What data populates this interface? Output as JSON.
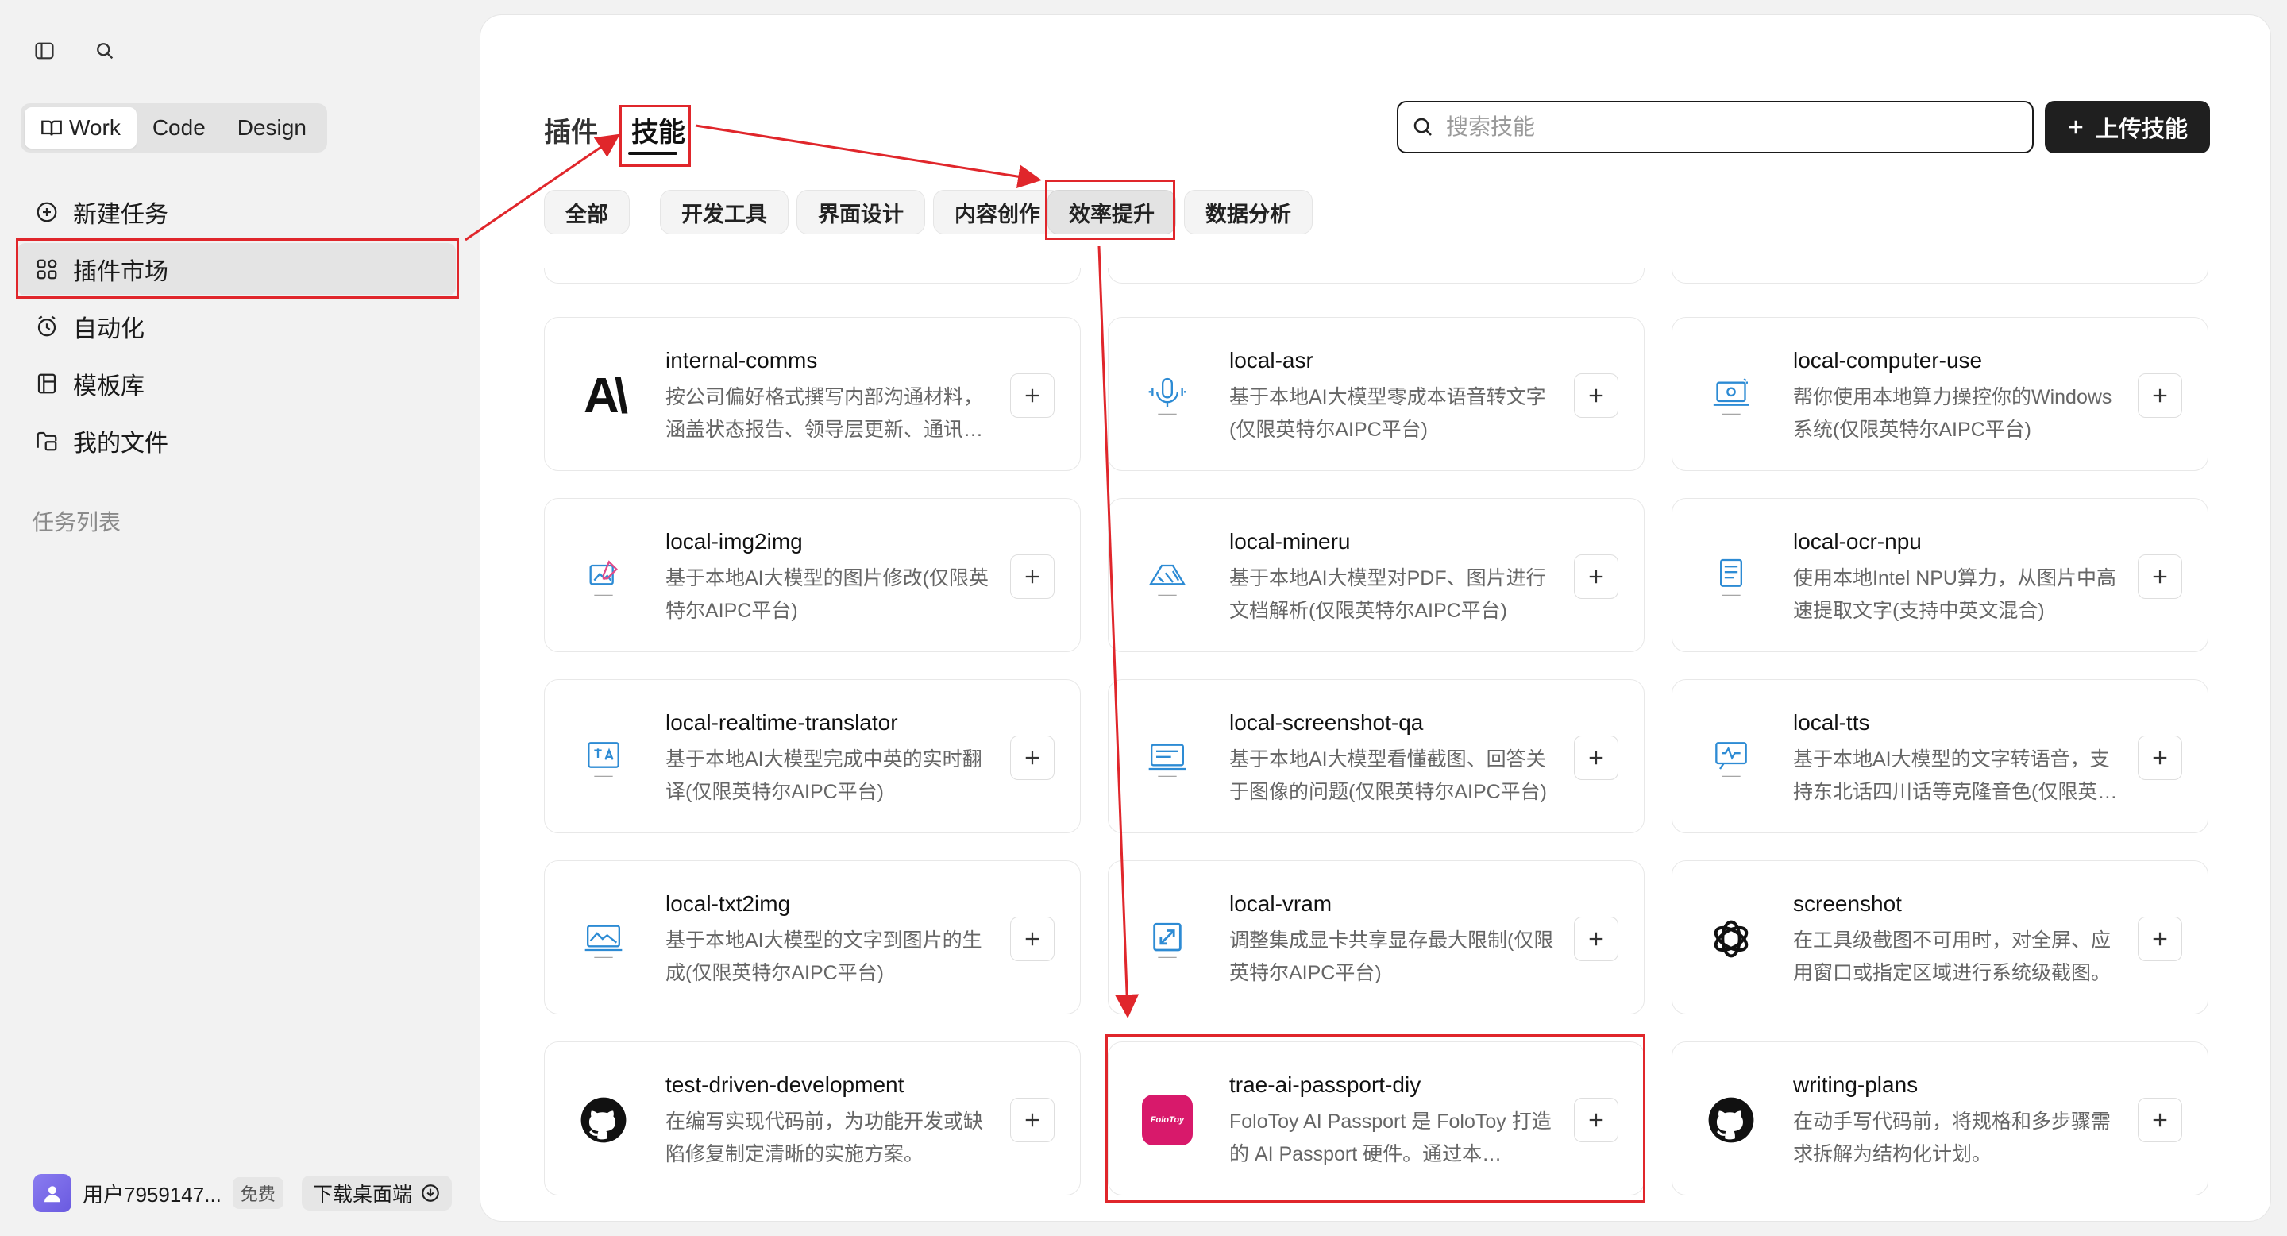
{
  "sidebar": {
    "modes": [
      "Work",
      "Code",
      "Design"
    ],
    "nav": [
      {
        "label": "新建任务",
        "icon": "plus-circle-icon"
      },
      {
        "label": "插件市场",
        "icon": "apps-icon"
      },
      {
        "label": "自动化",
        "icon": "clock-icon"
      },
      {
        "label": "模板库",
        "icon": "template-icon"
      },
      {
        "label": "我的文件",
        "icon": "folder-icon"
      }
    ],
    "section_title": "任务列表",
    "user": {
      "name": "用户7959147...",
      "plan": "免费"
    },
    "download_label": "下载桌面端"
  },
  "header": {
    "tabs": [
      "插件",
      "技能"
    ],
    "search_placeholder": "搜索技能",
    "upload_label": "上传技能"
  },
  "categories": [
    "全部",
    "开发工具",
    "界面设计",
    "内容创作",
    "效率提升",
    "数据分析"
  ],
  "skills": [
    {
      "title": "internal-comms",
      "desc": "按公司偏好格式撰写内部沟通材料，涵盖状态报告、领导层更新、通讯…",
      "icon": "anthropic-logo-icon"
    },
    {
      "title": "local-asr",
      "desc": "基于本地AI大模型零成本语音转文字(仅限英特尔AIPC平台)",
      "icon": "microphone-icon"
    },
    {
      "title": "local-computer-use",
      "desc": "帮你使用本地算力操控你的Windows系统(仅限英特尔AIPC平台)",
      "icon": "computer-icon"
    },
    {
      "title": "local-img2img",
      "desc": "基于本地AI大模型的图片修改(仅限英特尔AIPC平台)",
      "icon": "image-edit-icon"
    },
    {
      "title": "local-mineru",
      "desc": "基于本地AI大模型对PDF、图片进行文档解析(仅限英特尔AIPC平台)",
      "icon": "document-parse-icon"
    },
    {
      "title": "local-ocr-npu",
      "desc": "使用本地Intel NPU算力，从图片中高速提取文字(支持中英文混合)",
      "icon": "ocr-document-icon"
    },
    {
      "title": "local-realtime-translator",
      "desc": "基于本地AI大模型完成中英的实时翻译(仅限英特尔AIPC平台)",
      "icon": "translate-icon"
    },
    {
      "title": "local-screenshot-qa",
      "desc": "基于本地AI大模型看懂截图、回答关于图像的问题(仅限英特尔AIPC平台)",
      "icon": "screenshot-qa-icon"
    },
    {
      "title": "local-tts",
      "desc": "基于本地AI大模型的文字转语音，支持东北话四川话等克隆音色(仅限英…",
      "icon": "speech-icon"
    },
    {
      "title": "local-txt2img",
      "desc": "基于本地AI大模型的文字到图片的生成(仅限英特尔AIPC平台)",
      "icon": "text-to-image-icon"
    },
    {
      "title": "local-vram",
      "desc": "调整集成显卡共享显存最大限制(仅限英特尔AIPC平台)",
      "icon": "memory-expand-icon"
    },
    {
      "title": "screenshot",
      "desc": "在工具级截图不可用时，对全屏、应用窗口或指定区域进行系统级截图。",
      "icon": "openai-logo-icon"
    },
    {
      "title": "test-driven-development",
      "desc": "在编写实现代码前，为功能开发或缺陷修复制定清晰的实施方案。",
      "icon": "github-icon"
    },
    {
      "title": "trae-ai-passport-diy",
      "desc": "FoloToy AI Passport 是 FoloToy 打造的 AI Passport 硬件。通过本 Skill，…",
      "icon": "folotoy-logo-icon",
      "logo_text": "FoloToy"
    },
    {
      "title": "writing-plans",
      "desc": "在动手写代码前，将规格和多步骤需求拆解为结构化计划。",
      "icon": "github-icon"
    }
  ],
  "colors": {
    "annotation": "#e0262b",
    "primary_button": "#1f1f1f",
    "folotoy": "#d8196b"
  }
}
